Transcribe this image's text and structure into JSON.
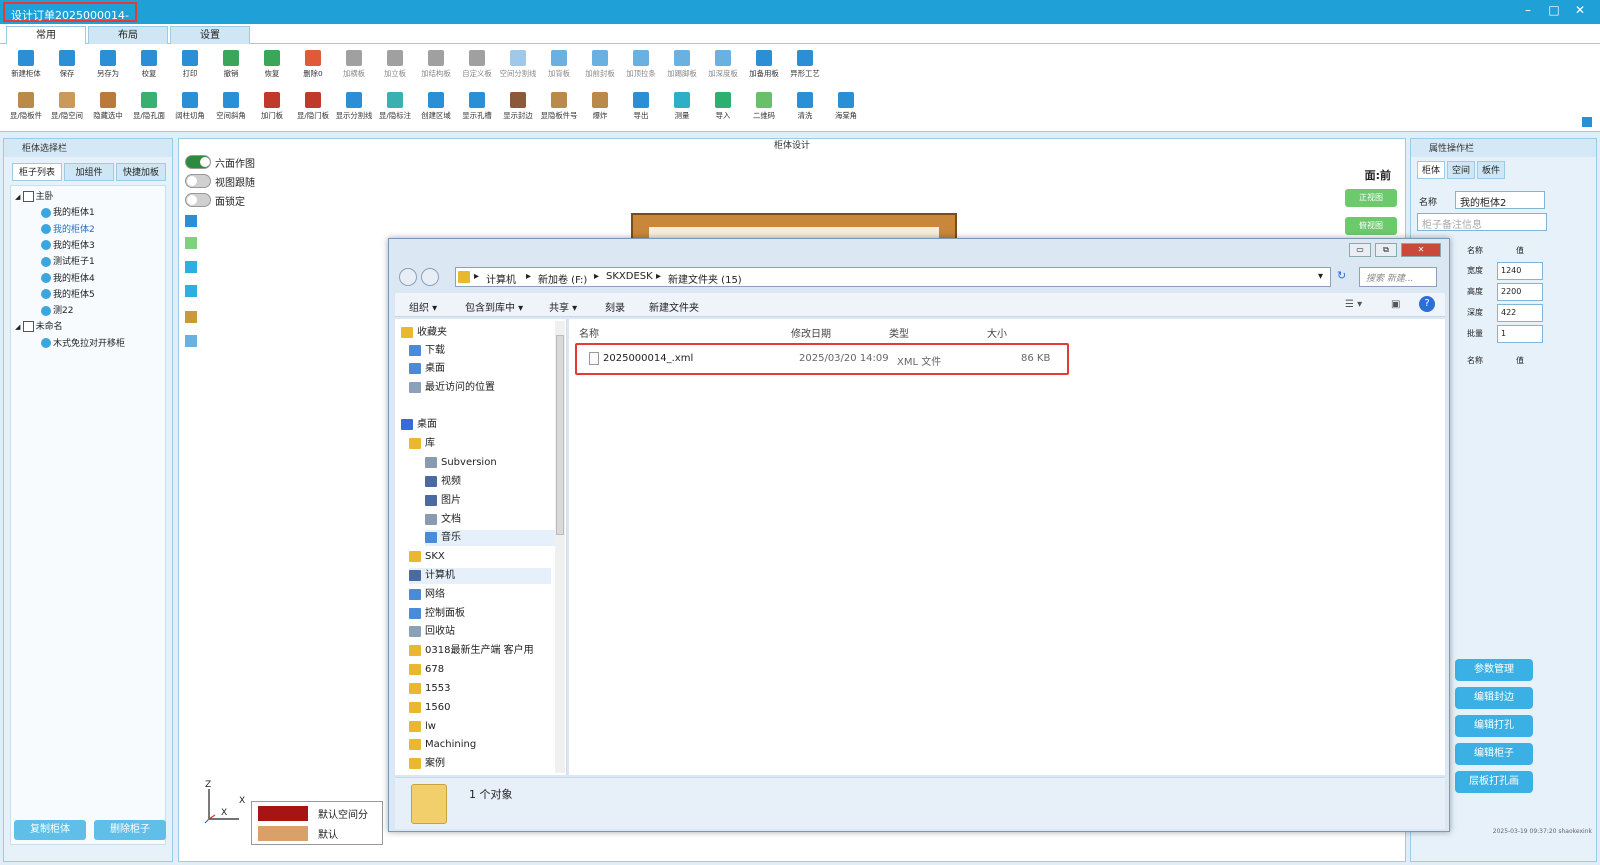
{
  "window": {
    "title": "设计订单2025000014-"
  },
  "ribbon_tabs": [
    "常用",
    "布局",
    "设置"
  ],
  "toolbar_row1": [
    {
      "label": "新建柜体",
      "icon": "new-cabinet-icon",
      "color": "#2b8fd6"
    },
    {
      "label": "保存",
      "icon": "save-icon",
      "color": "#2b8fd6"
    },
    {
      "label": "另存为",
      "icon": "save-as-icon",
      "color": "#2b8fd6"
    },
    {
      "label": "校复",
      "icon": "verify-icon",
      "color": "#2b8fd6"
    },
    {
      "label": "打印",
      "icon": "print-icon",
      "color": "#2b8fd6"
    },
    {
      "label": "撤销",
      "icon": "undo-icon",
      "color": "#3aa65a"
    },
    {
      "label": "恢复",
      "icon": "redo-icon",
      "color": "#3aa65a"
    },
    {
      "label": "删除0",
      "icon": "delete-icon",
      "color": "#e05a3a"
    },
    {
      "label": "加横板",
      "icon": "add-horizontal-board-icon",
      "color": "#a0a0a0"
    },
    {
      "label": "加立板",
      "icon": "add-vertical-board-icon",
      "color": "#a0a0a0"
    },
    {
      "label": "加结构板",
      "icon": "add-structure-board-icon",
      "color": "#a0a0a0"
    },
    {
      "label": "自定义板",
      "icon": "custom-board-icon",
      "color": "#a0a0a0"
    },
    {
      "label": "空间分割线",
      "icon": "space-divider-icon",
      "color": "#a0c8e8"
    },
    {
      "label": "加背板",
      "icon": "add-back-board-icon",
      "color": "#6ab0e0"
    },
    {
      "label": "加前封板",
      "icon": "add-front-seal-icon",
      "color": "#6ab0e0"
    },
    {
      "label": "加顶拉条",
      "icon": "add-top-strip-icon",
      "color": "#6ab0e0"
    },
    {
      "label": "加踢脚板",
      "icon": "add-kickboard-icon",
      "color": "#6ab0e0"
    },
    {
      "label": "加深度板",
      "icon": "add-depth-board-icon",
      "color": "#6ab0e0"
    },
    {
      "label": "加备用板",
      "icon": "add-spare-board-icon",
      "color": "#2b8fd6"
    },
    {
      "label": "异形工艺",
      "icon": "shaped-craft-icon",
      "color": "#2b8fd6"
    }
  ],
  "toolbar_row2": [
    {
      "label": "显/隐板件",
      "icon": "show-hide-board-icon",
      "color": "#b98a4a"
    },
    {
      "label": "显/隐空间",
      "icon": "show-hide-space-icon",
      "color": "#c99a5a"
    },
    {
      "label": "隐藏选中",
      "icon": "hide-selected-icon",
      "color": "#b97a3a"
    },
    {
      "label": "显/隐孔面",
      "icon": "show-hide-hole-face-icon",
      "color": "#3ab070"
    },
    {
      "label": "阔柱切角",
      "icon": "column-chamfer-icon",
      "color": "#2b8fd6"
    },
    {
      "label": "空间斜角",
      "icon": "space-bevel-icon",
      "color": "#2b8fd6"
    },
    {
      "label": "加门板",
      "icon": "add-door-icon",
      "color": "#c0392b"
    },
    {
      "label": "显/隐门板",
      "icon": "show-hide-door-icon",
      "color": "#c0392b"
    },
    {
      "label": "显示分割线",
      "icon": "show-divider-icon",
      "color": "#2b8fd6"
    },
    {
      "label": "显/隐标注",
      "icon": "show-hide-dimension-icon",
      "color": "#3ab0b0"
    },
    {
      "label": "创建区域",
      "icon": "create-region-icon",
      "color": "#2b8fd6"
    },
    {
      "label": "显示孔槽",
      "icon": "show-holes-icon",
      "color": "#2b8fd6"
    },
    {
      "label": "显示封边",
      "icon": "show-edge-band-icon",
      "color": "#8a5a3a"
    },
    {
      "label": "显隐板件号",
      "icon": "show-board-number-icon",
      "color": "#b98a4a"
    },
    {
      "label": "爆炸",
      "icon": "explode-icon",
      "color": "#b98a4a"
    },
    {
      "label": "导出",
      "icon": "export-icon",
      "color": "#2b8fd6"
    },
    {
      "label": "测量",
      "icon": "measure-icon",
      "color": "#2bb0c8"
    },
    {
      "label": "导入",
      "icon": "import-icon",
      "color": "#2bb070"
    },
    {
      "label": "二维码",
      "icon": "qrcode-icon",
      "color": "#6ac06a"
    },
    {
      "label": "清洗",
      "icon": "clean-icon",
      "color": "#2b8fd6"
    },
    {
      "label": "海棠角",
      "icon": "begonia-corner-icon",
      "color": "#2b8fd6"
    }
  ],
  "left_panel": {
    "title": "柜体选择栏",
    "tabs": [
      "柜子列表",
      "加组件",
      "快捷加板"
    ],
    "tree": [
      {
        "label": "主卧",
        "level": 0,
        "type": "folder"
      },
      {
        "label": "我的柜体1",
        "level": 1,
        "type": "item"
      },
      {
        "label": "我的柜体2",
        "level": 1,
        "type": "item",
        "selected": true
      },
      {
        "label": "我的柜体3",
        "level": 1,
        "type": "item"
      },
      {
        "label": "测试柜子1",
        "level": 1,
        "type": "item"
      },
      {
        "label": "我的柜体4",
        "level": 1,
        "type": "item"
      },
      {
        "label": "我的柜体5",
        "level": 1,
        "type": "item"
      },
      {
        "label": "测22",
        "level": 1,
        "type": "item"
      },
      {
        "label": "未命名",
        "level": 0,
        "type": "folder"
      },
      {
        "label": "木式免拉对开移柜",
        "level": 1,
        "type": "item"
      }
    ],
    "buttons": [
      "复制柜体",
      "删除柜子"
    ]
  },
  "center": {
    "title": "柜体设计",
    "toggles": [
      {
        "label": "六面作图",
        "on": true
      },
      {
        "label": "视图跟随",
        "on": false
      },
      {
        "label": "面锁定",
        "on": false
      }
    ],
    "view_label": "面:前",
    "view_buttons": [
      "正视图",
      "俯视图"
    ],
    "axis": {
      "z": "Z",
      "x": "X"
    },
    "legend": [
      {
        "label": "默认空间分",
        "color": "#a61414"
      },
      {
        "label": "默认",
        "color": "#d9a06a"
      }
    ]
  },
  "right_panel": {
    "title": "属性操作栏",
    "tabs": [
      "柜体",
      "空间",
      "板件"
    ],
    "name_label": "名称",
    "name_value": "我的柜体2",
    "remark_placeholder": "柜子备注信息",
    "grid_header": {
      "k": "名称",
      "v": "值"
    },
    "props": [
      {
        "k": "宽度",
        "v": "1240"
      },
      {
        "k": "高度",
        "v": "2200"
      },
      {
        "k": "深度",
        "v": "422"
      },
      {
        "k": "批量",
        "v": "1"
      }
    ],
    "grid2_header": {
      "k": "名称",
      "v": "值"
    },
    "buttons": [
      "参数管理",
      "编辑封边",
      "编辑打孔",
      "编辑柜子",
      "层板打孔画"
    ],
    "stamp": "2025-03-19 09:37:20 shaokexink"
  },
  "explorer": {
    "breadcrumb": [
      "计算机",
      "新加卷 (F:)",
      "SKXDESK",
      "新建文件夹 (15)"
    ],
    "search_placeholder": "搜索 新建...",
    "commands": [
      "组织 ▾",
      "包含到库中 ▾",
      "共享 ▾",
      "刻录",
      "新建文件夹"
    ],
    "nav": [
      {
        "label": "收藏夹",
        "indent": 0,
        "color": "#e8b830"
      },
      {
        "label": "下载",
        "indent": 1,
        "color": "#4a8ad6"
      },
      {
        "label": "桌面",
        "indent": 1,
        "color": "#4a8ad6"
      },
      {
        "label": "最近访问的位置",
        "indent": 1,
        "color": "#8aa1b8"
      },
      {
        "label": "桌面",
        "indent": 0,
        "color": "#3a6ad6"
      },
      {
        "label": "库",
        "indent": 1,
        "color": "#e8b830"
      },
      {
        "label": "Subversion",
        "indent": 2,
        "color": "#8a9ab0"
      },
      {
        "label": "视频",
        "indent": 2,
        "color": "#4a6aa0"
      },
      {
        "label": "图片",
        "indent": 2,
        "color": "#4a6aa0"
      },
      {
        "label": "文档",
        "indent": 2,
        "color": "#8a9ab0"
      },
      {
        "label": "音乐",
        "indent": 2,
        "color": "#4a8ad6"
      },
      {
        "label": "SKX",
        "indent": 1,
        "color": "#e8b830"
      },
      {
        "label": "计算机",
        "indent": 1,
        "color": "#4a6aa0"
      },
      {
        "label": "网络",
        "indent": 1,
        "color": "#4a8ad6"
      },
      {
        "label": "控制面板",
        "indent": 1,
        "color": "#4a8ad6"
      },
      {
        "label": "回收站",
        "indent": 1,
        "color": "#8aa1b8"
      },
      {
        "label": "0318最新生产端 客户用",
        "indent": 1,
        "color": "#e8b830"
      },
      {
        "label": "678",
        "indent": 1,
        "color": "#e8b830"
      },
      {
        "label": "1553",
        "indent": 1,
        "color": "#e8b830"
      },
      {
        "label": "1560",
        "indent": 1,
        "color": "#e8b830"
      },
      {
        "label": "lw",
        "indent": 1,
        "color": "#e8b830"
      },
      {
        "label": "Machining",
        "indent": 1,
        "color": "#e8b830"
      },
      {
        "label": "案例",
        "indent": 1,
        "color": "#e8b830"
      }
    ],
    "columns": [
      "名称",
      "修改日期",
      "类型",
      "大小"
    ],
    "files": [
      {
        "name": "2025000014_.xml",
        "date": "2025/03/20 14:09",
        "type": "XML 文件",
        "size": "86 KB"
      }
    ],
    "status": "1 个对象"
  }
}
